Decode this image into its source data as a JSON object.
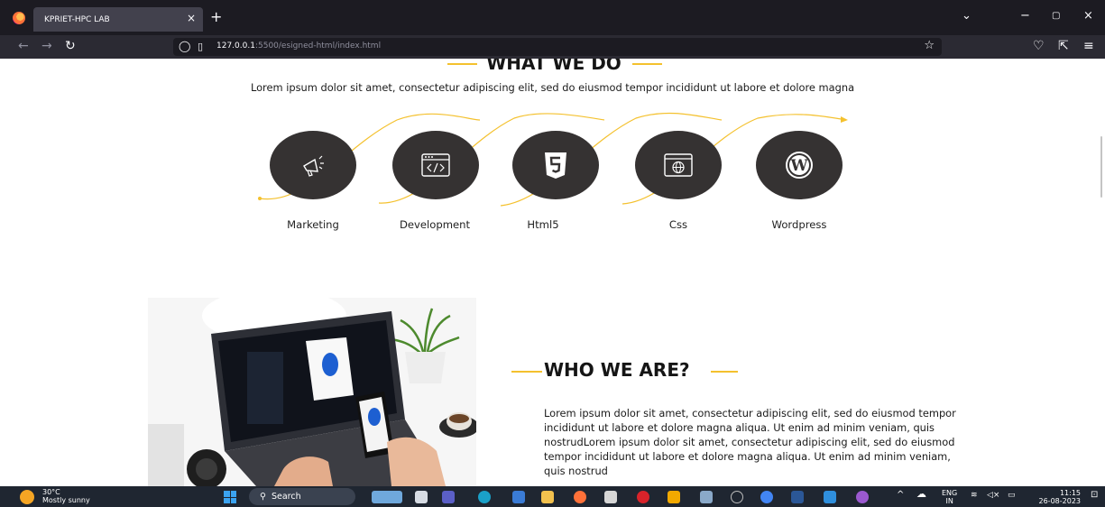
{
  "browser": {
    "tab_title": "KPRIET-HPC LAB",
    "tab_close": "×",
    "new_tab": "+",
    "url_host": "127.0.0.1",
    "url_path": ":5500/esigned-html/index.html",
    "window_controls": [
      "⌄",
      "−",
      "▢",
      "×"
    ]
  },
  "what_we_do": {
    "heading": "WHAT WE DO",
    "intro": "Lorem ipsum dolor sit amet, consectetur adipiscing elit, sed do eiusmod tempor incididunt ut labore et dolore magna",
    "services": [
      {
        "label": "Marketing",
        "icon": "megaphone-icon"
      },
      {
        "label": "Development",
        "icon": "code-window-icon"
      },
      {
        "label": "Html5",
        "icon": "html5-icon"
      },
      {
        "label": "Css",
        "icon": "globe-window-icon"
      },
      {
        "label": "Wordpress",
        "icon": "wordpress-icon"
      }
    ]
  },
  "who_we_are": {
    "heading": "WHO WE ARE?",
    "body": "Lorem ipsum dolor sit amet, consectetur adipiscing elit, sed do eiusmod tempor incididunt ut labore et dolore magna aliqua. Ut enim ad minim veniam, quis nostrudLorem ipsum dolor sit amet, consectetur adipiscing elit, sed do eiusmod tempor incididunt ut labore et dolore magna aliqua. Ut enim ad minim veniam, quis nostrud"
  },
  "taskbar": {
    "weather_temp": "30°C",
    "weather_desc": "Mostly sunny",
    "search_label": "Search",
    "lang_top": "ENG",
    "lang_bottom": "IN",
    "time": "11:15",
    "date": "26-08-2023"
  },
  "colors": {
    "accent": "#f4c12e",
    "circle": "#353232",
    "tabbar": "#1c1b22",
    "taskbar": "#1f2631"
  }
}
